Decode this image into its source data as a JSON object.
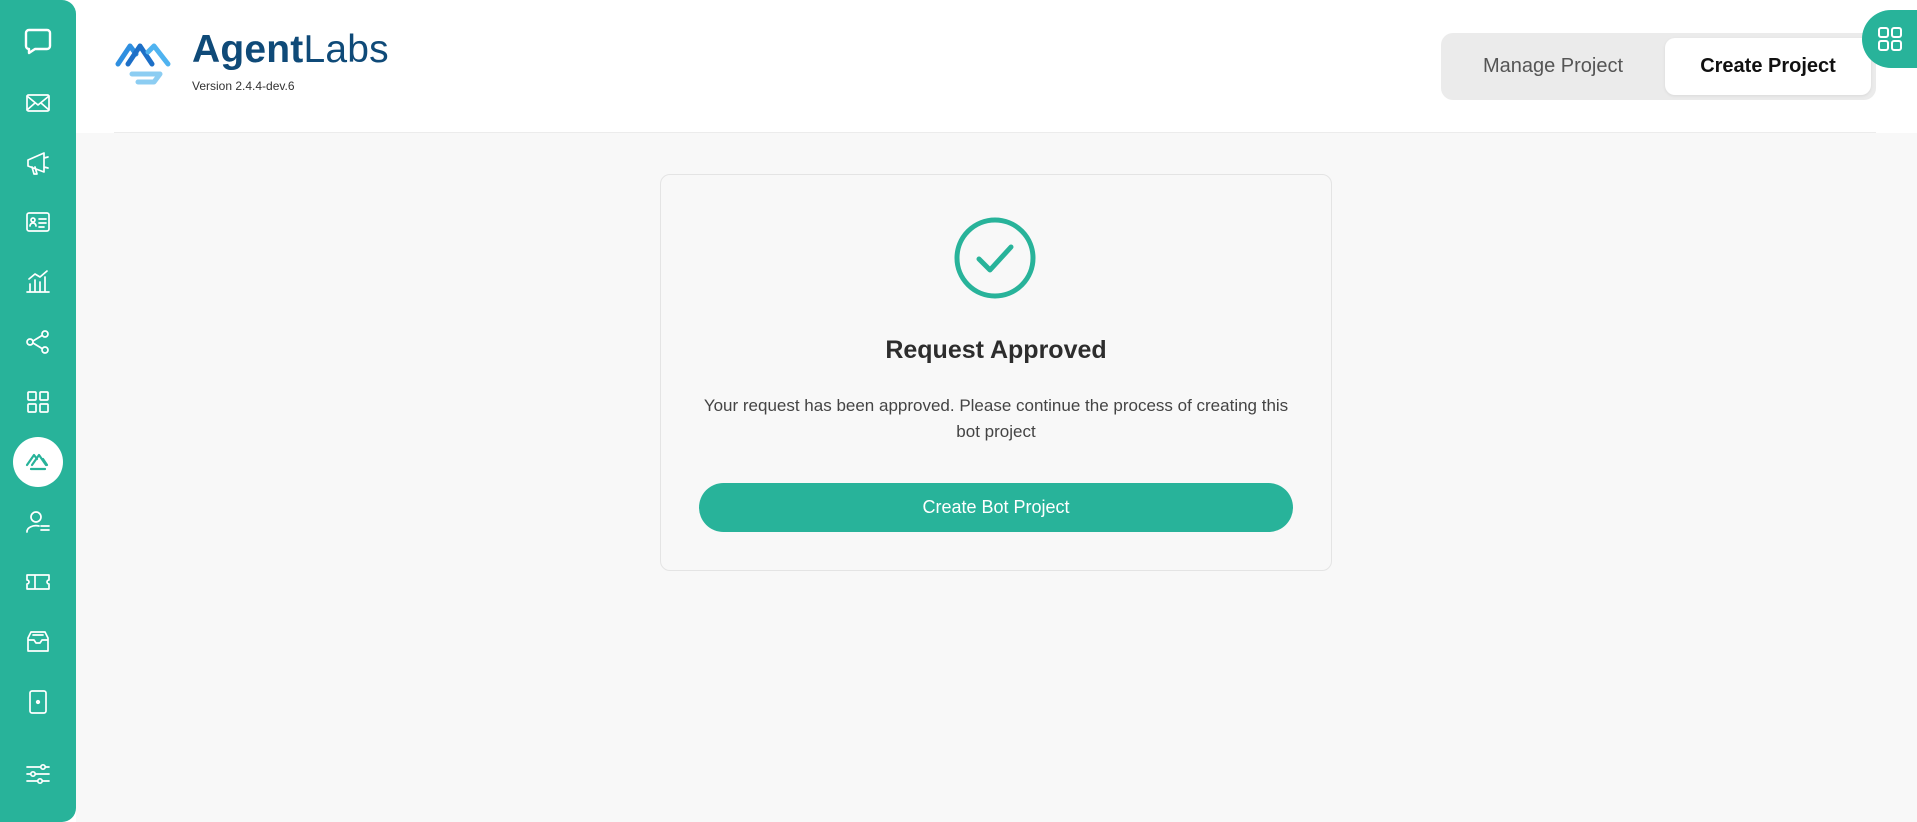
{
  "app": {
    "brand_bold": "Agent",
    "brand_light": "Labs",
    "version": "Version 2.4.4-dev.6"
  },
  "sidebar": {
    "items": [
      {
        "icon": "chat-icon"
      },
      {
        "icon": "mail-icon"
      },
      {
        "icon": "megaphone-icon"
      },
      {
        "icon": "contact-card-icon"
      },
      {
        "icon": "analytics-icon"
      },
      {
        "icon": "share-nodes-icon"
      },
      {
        "icon": "apps-grid-icon"
      },
      {
        "icon": "agentlabs-icon",
        "active": true
      },
      {
        "icon": "agent-user-icon"
      },
      {
        "icon": "ticket-icon"
      },
      {
        "icon": "inbox-icon"
      },
      {
        "icon": "mobile-device-icon"
      },
      {
        "icon": "settings-sliders-icon"
      }
    ]
  },
  "header": {
    "tabs": [
      {
        "label": "Manage Project",
        "active": false
      },
      {
        "label": "Create Project",
        "active": true
      }
    ]
  },
  "card": {
    "icon": "check-circle-icon",
    "title": "Request Approved",
    "description": "Your request has been approved. Please continue the process of creating this bot project",
    "button_label": "Create Bot Project"
  },
  "colors": {
    "accent": "#28b39a",
    "brand_text": "#0f4a78",
    "logo_blue": "#2f8fe0"
  }
}
